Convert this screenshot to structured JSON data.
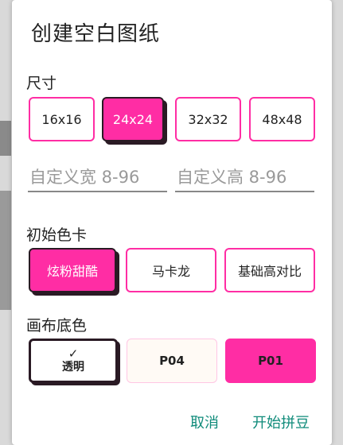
{
  "dialog": {
    "title": "创建空白图纸",
    "size_label": "尺寸",
    "sizes": [
      "16x16",
      "24x24",
      "32x32",
      "48x48"
    ],
    "selected_size": "24x24",
    "custom_width_placeholder": "自定义宽 8-96",
    "custom_height_placeholder": "自定义高 8-96",
    "palette_label": "初始色卡",
    "palettes": [
      "炫粉甜酷",
      "马卡龙",
      "基础高对比"
    ],
    "selected_palette": "炫粉甜酷",
    "bg_label": "画布底色",
    "bg_options": [
      {
        "check": "✓",
        "label": "透明"
      },
      {
        "label": "P04"
      },
      {
        "label": "P01"
      }
    ],
    "cancel_label": "取消",
    "start_label": "开始拼豆"
  },
  "colors": {
    "accent": "#ff2da4",
    "action_text": "#0f8b7a",
    "dark_outline": "#2a1a24"
  }
}
